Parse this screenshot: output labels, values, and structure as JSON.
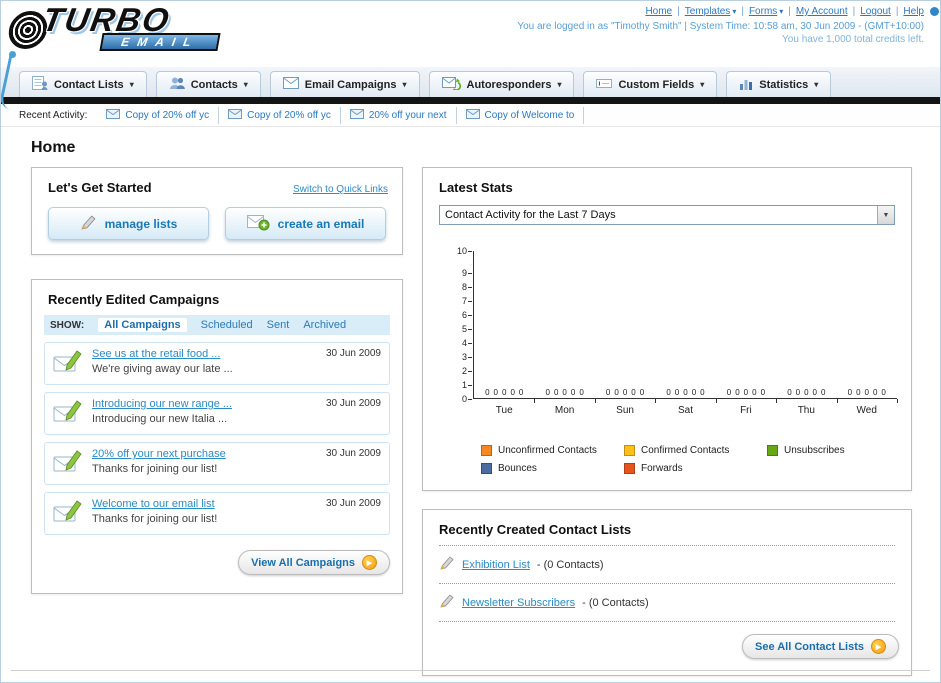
{
  "header": {
    "logo_title": "TURBO",
    "logo_subtitle": "EMAIL",
    "top_links": {
      "home": "Home",
      "templates": "Templates",
      "forms": "Forms",
      "my_account": "My Account",
      "logout": "Logout",
      "help": "Help"
    },
    "login_info": "You are logged in as \"Timothy Smith\" | System Time: 10:58 am, 30 Jun 2009 - (GMT+10:00)",
    "credits_info": "You have 1,000 total credits left."
  },
  "nav_tabs": [
    {
      "label": "Contact Lists"
    },
    {
      "label": "Contacts"
    },
    {
      "label": "Email Campaigns"
    },
    {
      "label": "Autoresponders"
    },
    {
      "label": "Custom Fields"
    },
    {
      "label": "Statistics"
    }
  ],
  "recent_activity": {
    "label": "Recent Activity:",
    "items": [
      {
        "text": "Copy of 20% off yc"
      },
      {
        "text": "Copy of 20% off yc"
      },
      {
        "text": "20% off your next"
      },
      {
        "text": "Copy of Welcome to"
      }
    ]
  },
  "page_title": "Home",
  "get_started": {
    "title": "Let's Get Started",
    "switch_link": "Switch to Quick Links",
    "manage_lists_label": "manage lists",
    "create_email_label": "create an email"
  },
  "campaigns_panel": {
    "title": "Recently Edited Campaigns",
    "show_label": "SHOW:",
    "filters": [
      {
        "label": "All Campaigns",
        "active": true
      },
      {
        "label": "Scheduled",
        "active": false
      },
      {
        "label": "Sent",
        "active": false
      },
      {
        "label": "Archived",
        "active": false
      }
    ],
    "items": [
      {
        "title": "See us at the retail food ...",
        "subtitle": "We're giving away our late ...",
        "date": "30 Jun 2009"
      },
      {
        "title": "Introducing our new range ...",
        "subtitle": "Introducing our new Italia ...",
        "date": "30 Jun 2009"
      },
      {
        "title": "20% off your next purchase",
        "subtitle": "Thanks for joining our list!",
        "date": "30 Jun 2009"
      },
      {
        "title": "Welcome to our email list",
        "subtitle": "Thanks for joining our list!",
        "date": "30 Jun 2009"
      }
    ],
    "view_all_label": "View All Campaigns"
  },
  "stats_panel": {
    "title": "Latest Stats",
    "dropdown_value": "Contact Activity for the Last 7 Days"
  },
  "chart_data": {
    "type": "bar",
    "title": "Contact Activity for the Last 7 Days",
    "categories": [
      "Tue",
      "Mon",
      "Sun",
      "Sat",
      "Fri",
      "Thu",
      "Wed"
    ],
    "series": [
      {
        "name": "Unconfirmed Contacts",
        "color": "#f5891f",
        "values": [
          0,
          0,
          0,
          0,
          0,
          0,
          0
        ]
      },
      {
        "name": "Confirmed Contacts",
        "color": "#fdc01a",
        "values": [
          0,
          0,
          0,
          0,
          0,
          0,
          0
        ]
      },
      {
        "name": "Unsubscribes",
        "color": "#64a813",
        "values": [
          0,
          0,
          0,
          0,
          0,
          0,
          0
        ]
      },
      {
        "name": "Bounces",
        "color": "#4a6d9e",
        "values": [
          0,
          0,
          0,
          0,
          0,
          0,
          0
        ]
      },
      {
        "name": "Forwards",
        "color": "#e8541e",
        "values": [
          0,
          0,
          0,
          0,
          0,
          0,
          0
        ]
      }
    ],
    "ylim": [
      0,
      10
    ],
    "yticks": [
      0,
      1,
      2,
      3,
      4,
      5,
      6,
      7,
      8,
      9,
      10
    ],
    "legend_position": "bottom",
    "grid": false
  },
  "contact_lists_panel": {
    "title": "Recently Created Contact Lists",
    "items": [
      {
        "name": "Exhibition List",
        "suffix": " - (0 Contacts)"
      },
      {
        "name": "Newsletter Subscribers",
        "suffix": " - (0 Contacts)"
      }
    ],
    "see_all_label": "See All Contact Lists"
  },
  "colors": {
    "accent_blue": "#2a79c0",
    "black_bar": "#141414",
    "button_orange": "#f59a1a"
  }
}
